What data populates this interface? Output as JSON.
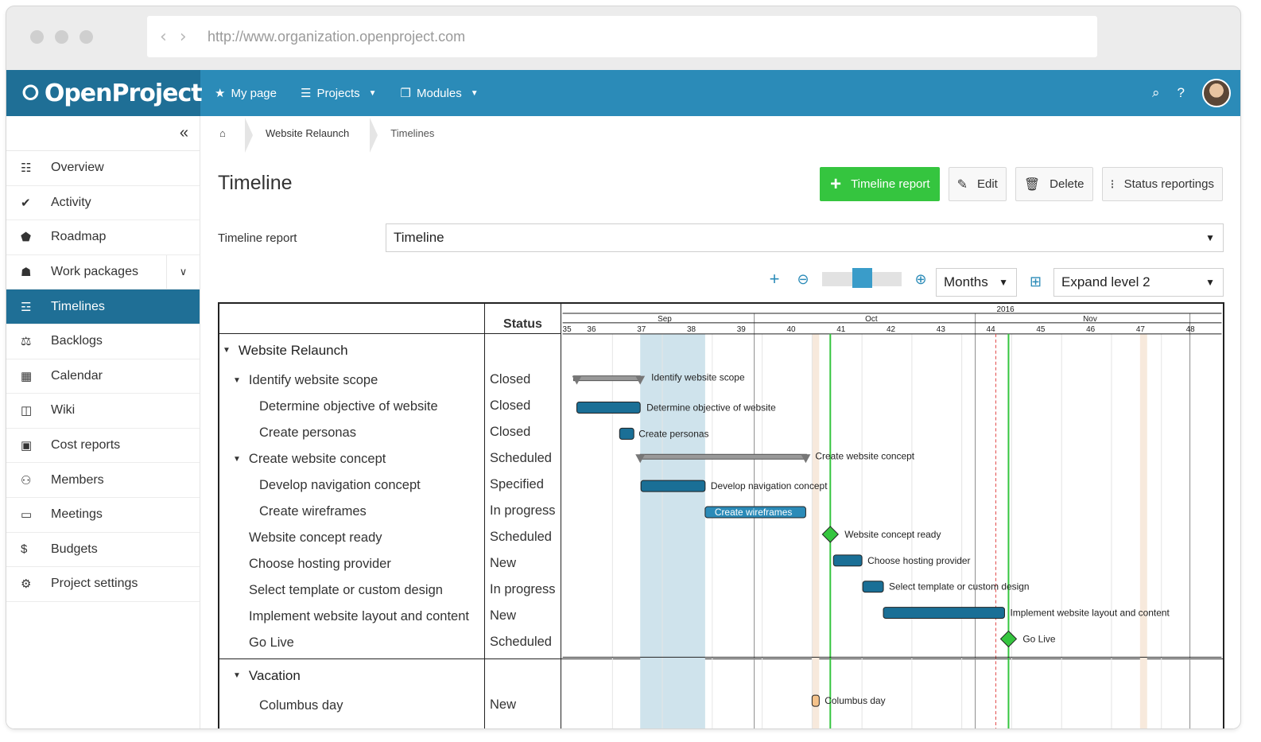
{
  "browser": {
    "url": "http://www.organization.openproject.com"
  },
  "topbar": {
    "logo_text": "OpenProject",
    "nav": [
      {
        "icon": "star-icon",
        "label": "My page"
      },
      {
        "icon": "layers-icon",
        "label": "Projects"
      },
      {
        "icon": "cube-icon",
        "label": "Modules"
      }
    ]
  },
  "sidebar": {
    "items": [
      {
        "icon": "list-icon",
        "label": "Overview"
      },
      {
        "icon": "checkmark-icon",
        "label": "Activity"
      },
      {
        "icon": "tag-icon",
        "label": "Roadmap"
      },
      {
        "icon": "hierarchy-icon",
        "label": "Work packages"
      },
      {
        "icon": "timeline-icon",
        "label": "Timelines"
      },
      {
        "icon": "backlogs-icon",
        "label": "Backlogs"
      },
      {
        "icon": "calendar-icon",
        "label": "Calendar"
      },
      {
        "icon": "book-icon",
        "label": "Wiki"
      },
      {
        "icon": "chart-icon",
        "label": "Cost reports"
      },
      {
        "icon": "members-icon",
        "label": "Members"
      },
      {
        "icon": "speech-bubble-icon",
        "label": "Meetings"
      },
      {
        "icon": "budget-icon",
        "label": "Budgets"
      },
      {
        "icon": "gears-icon",
        "label": "Project settings"
      }
    ]
  },
  "breadcrumb": {
    "project": "Website Relaunch",
    "page": "Timelines"
  },
  "page": {
    "title": "Timeline",
    "buttons": {
      "timeline_report": "Timeline report",
      "edit": "Edit",
      "delete": "Delete",
      "status_reportings": "Status reportings"
    },
    "report_label": "Timeline report",
    "report_value": "Timeline"
  },
  "controls": {
    "zoom_level": "Months",
    "expand_level": "Expand level 2",
    "slider_position": 0.5
  },
  "timeline": {
    "status_header": "Status",
    "year": "2016",
    "months": [
      "Sep",
      "Oct",
      "Nov"
    ],
    "weeks": [
      "35",
      "36",
      "37",
      "38",
      "39",
      "40",
      "41",
      "42",
      "43",
      "44",
      "45",
      "46",
      "47",
      "48"
    ],
    "groups": [
      {
        "name": "Website Relaunch",
        "rows": [
          {
            "name": "Identify website scope",
            "status": "Closed",
            "level": 1,
            "type": "parent",
            "label": "Identify website scope"
          },
          {
            "name": "Determine objective of website",
            "status": "Closed",
            "level": 2,
            "type": "task",
            "label": "Determine objective of website"
          },
          {
            "name": "Create personas",
            "status": "Closed",
            "level": 2,
            "type": "task",
            "label": "Create personas"
          },
          {
            "name": "Create website concept",
            "status": "Scheduled",
            "level": 1,
            "type": "parent",
            "label": "Create website concept"
          },
          {
            "name": "Develop navigation concept",
            "status": "Specified",
            "level": 2,
            "type": "task",
            "label": "Develop navigation concept"
          },
          {
            "name": "Create wireframes",
            "status": "In progress",
            "level": 2,
            "type": "task-highlight",
            "label": "Create wireframes"
          },
          {
            "name": "Website concept ready",
            "status": "Scheduled",
            "level": 1,
            "type": "milestone",
            "label": "Website concept ready"
          },
          {
            "name": "Choose hosting provider",
            "status": "New",
            "level": 1,
            "type": "task",
            "label": "Choose hosting provider"
          },
          {
            "name": "Select template or custom design",
            "status": "In progress",
            "level": 1,
            "type": "task",
            "label": "Select template or custom design"
          },
          {
            "name": "Implement website layout and content",
            "status": "New",
            "level": 1,
            "type": "task",
            "label": "Implement website layout and content"
          },
          {
            "name": "Go Live",
            "status": "Scheduled",
            "level": 1,
            "type": "milestone",
            "label": "Go Live"
          }
        ]
      },
      {
        "name": "Vacation",
        "rows": [
          {
            "name": "Columbus day",
            "status": "New",
            "level": 2,
            "type": "vacation",
            "label": "Columbus day"
          }
        ]
      }
    ],
    "colors": {
      "bar": "#1a6f96",
      "bar_highlight": "#2b8bb8",
      "milestone": "#35c53f",
      "parent": "#999999",
      "vacation": "#f5c28a",
      "highlight_band": "#cfe3ec",
      "today_line": "#e24c4c",
      "green_line": "#35c53f"
    }
  }
}
